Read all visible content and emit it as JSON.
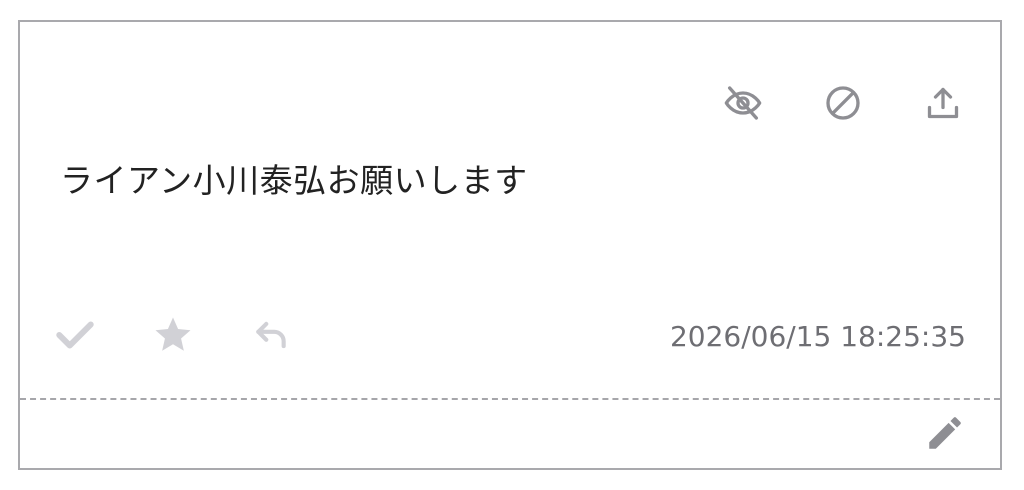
{
  "post": {
    "message": "ライアン小川泰弘お願いします",
    "timestamp": "2026/06/15 18:25:35"
  },
  "icons": {
    "top": [
      "eye-slash-icon",
      "ban-icon",
      "upload-icon"
    ],
    "bottom": [
      "check-icon",
      "star-icon",
      "reply-icon"
    ],
    "footer": [
      "pencil-icon"
    ]
  },
  "colors": {
    "icon_dark": "#8e8e93",
    "icon_light": "#d1d1d6",
    "border": "#a9a9ad",
    "text": "#222222",
    "timestamp": "#6e6e73"
  }
}
